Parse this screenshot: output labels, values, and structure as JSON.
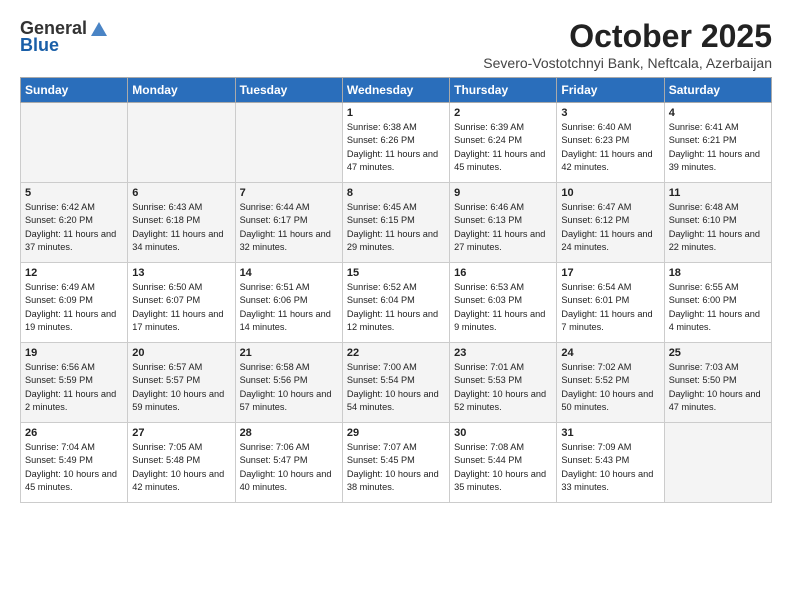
{
  "header": {
    "logo_general": "General",
    "logo_blue": "Blue",
    "month_title": "October 2025",
    "location": "Severo-Vostotchnyi Bank, Neftcala, Azerbaijan"
  },
  "weekdays": [
    "Sunday",
    "Monday",
    "Tuesday",
    "Wednesday",
    "Thursday",
    "Friday",
    "Saturday"
  ],
  "weeks": [
    [
      {
        "day": "",
        "info": ""
      },
      {
        "day": "",
        "info": ""
      },
      {
        "day": "",
        "info": ""
      },
      {
        "day": "1",
        "info": "Sunrise: 6:38 AM\nSunset: 6:26 PM\nDaylight: 11 hours and 47 minutes."
      },
      {
        "day": "2",
        "info": "Sunrise: 6:39 AM\nSunset: 6:24 PM\nDaylight: 11 hours and 45 minutes."
      },
      {
        "day": "3",
        "info": "Sunrise: 6:40 AM\nSunset: 6:23 PM\nDaylight: 11 hours and 42 minutes."
      },
      {
        "day": "4",
        "info": "Sunrise: 6:41 AM\nSunset: 6:21 PM\nDaylight: 11 hours and 39 minutes."
      }
    ],
    [
      {
        "day": "5",
        "info": "Sunrise: 6:42 AM\nSunset: 6:20 PM\nDaylight: 11 hours and 37 minutes."
      },
      {
        "day": "6",
        "info": "Sunrise: 6:43 AM\nSunset: 6:18 PM\nDaylight: 11 hours and 34 minutes."
      },
      {
        "day": "7",
        "info": "Sunrise: 6:44 AM\nSunset: 6:17 PM\nDaylight: 11 hours and 32 minutes."
      },
      {
        "day": "8",
        "info": "Sunrise: 6:45 AM\nSunset: 6:15 PM\nDaylight: 11 hours and 29 minutes."
      },
      {
        "day": "9",
        "info": "Sunrise: 6:46 AM\nSunset: 6:13 PM\nDaylight: 11 hours and 27 minutes."
      },
      {
        "day": "10",
        "info": "Sunrise: 6:47 AM\nSunset: 6:12 PM\nDaylight: 11 hours and 24 minutes."
      },
      {
        "day": "11",
        "info": "Sunrise: 6:48 AM\nSunset: 6:10 PM\nDaylight: 11 hours and 22 minutes."
      }
    ],
    [
      {
        "day": "12",
        "info": "Sunrise: 6:49 AM\nSunset: 6:09 PM\nDaylight: 11 hours and 19 minutes."
      },
      {
        "day": "13",
        "info": "Sunrise: 6:50 AM\nSunset: 6:07 PM\nDaylight: 11 hours and 17 minutes."
      },
      {
        "day": "14",
        "info": "Sunrise: 6:51 AM\nSunset: 6:06 PM\nDaylight: 11 hours and 14 minutes."
      },
      {
        "day": "15",
        "info": "Sunrise: 6:52 AM\nSunset: 6:04 PM\nDaylight: 11 hours and 12 minutes."
      },
      {
        "day": "16",
        "info": "Sunrise: 6:53 AM\nSunset: 6:03 PM\nDaylight: 11 hours and 9 minutes."
      },
      {
        "day": "17",
        "info": "Sunrise: 6:54 AM\nSunset: 6:01 PM\nDaylight: 11 hours and 7 minutes."
      },
      {
        "day": "18",
        "info": "Sunrise: 6:55 AM\nSunset: 6:00 PM\nDaylight: 11 hours and 4 minutes."
      }
    ],
    [
      {
        "day": "19",
        "info": "Sunrise: 6:56 AM\nSunset: 5:59 PM\nDaylight: 11 hours and 2 minutes."
      },
      {
        "day": "20",
        "info": "Sunrise: 6:57 AM\nSunset: 5:57 PM\nDaylight: 10 hours and 59 minutes."
      },
      {
        "day": "21",
        "info": "Sunrise: 6:58 AM\nSunset: 5:56 PM\nDaylight: 10 hours and 57 minutes."
      },
      {
        "day": "22",
        "info": "Sunrise: 7:00 AM\nSunset: 5:54 PM\nDaylight: 10 hours and 54 minutes."
      },
      {
        "day": "23",
        "info": "Sunrise: 7:01 AM\nSunset: 5:53 PM\nDaylight: 10 hours and 52 minutes."
      },
      {
        "day": "24",
        "info": "Sunrise: 7:02 AM\nSunset: 5:52 PM\nDaylight: 10 hours and 50 minutes."
      },
      {
        "day": "25",
        "info": "Sunrise: 7:03 AM\nSunset: 5:50 PM\nDaylight: 10 hours and 47 minutes."
      }
    ],
    [
      {
        "day": "26",
        "info": "Sunrise: 7:04 AM\nSunset: 5:49 PM\nDaylight: 10 hours and 45 minutes."
      },
      {
        "day": "27",
        "info": "Sunrise: 7:05 AM\nSunset: 5:48 PM\nDaylight: 10 hours and 42 minutes."
      },
      {
        "day": "28",
        "info": "Sunrise: 7:06 AM\nSunset: 5:47 PM\nDaylight: 10 hours and 40 minutes."
      },
      {
        "day": "29",
        "info": "Sunrise: 7:07 AM\nSunset: 5:45 PM\nDaylight: 10 hours and 38 minutes."
      },
      {
        "day": "30",
        "info": "Sunrise: 7:08 AM\nSunset: 5:44 PM\nDaylight: 10 hours and 35 minutes."
      },
      {
        "day": "31",
        "info": "Sunrise: 7:09 AM\nSunset: 5:43 PM\nDaylight: 10 hours and 33 minutes."
      },
      {
        "day": "",
        "info": ""
      }
    ]
  ]
}
